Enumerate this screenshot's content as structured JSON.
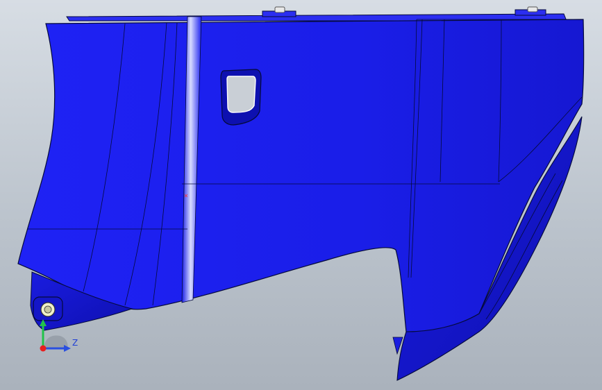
{
  "scene": {
    "background_top": "#d7dde4",
    "background_bottom": "#aab2bc",
    "part_color": "#1c1ff0",
    "part_shadow": "#0f12b8",
    "edge_color": "#050a3a",
    "highlight_color": "#d7dcff"
  },
  "triad": {
    "z_label": "Z",
    "x_axis_color": "#e81e1e",
    "y_axis_color": "#22c34a",
    "z_axis_color": "#2a4fe0"
  }
}
